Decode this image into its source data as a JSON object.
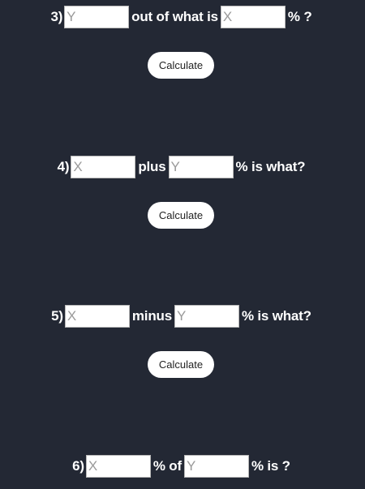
{
  "q3": {
    "number": "3)",
    "input1_placeholder": "Y",
    "text1": "out of what is",
    "input2_placeholder": "X",
    "text2": "% ?",
    "button_label": "Calculate"
  },
  "q4": {
    "number": "4)",
    "input1_placeholder": "X",
    "text1": "plus",
    "input2_placeholder": "Y",
    "text2": "% is what?",
    "button_label": "Calculate"
  },
  "q5": {
    "number": "5)",
    "input1_placeholder": "X",
    "text1": "minus",
    "input2_placeholder": "Y",
    "text2": "% is what?",
    "button_label": "Calculate"
  },
  "q6": {
    "number": "6)",
    "input1_placeholder": "X",
    "text1": "% of",
    "input2_placeholder": "Y",
    "text2": "% is ?"
  }
}
